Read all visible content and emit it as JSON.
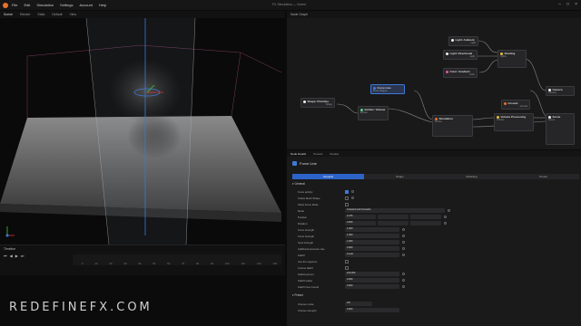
{
  "app": {
    "title": "FX Simulation — Scene"
  },
  "menu": [
    "File",
    "Edit",
    "Simulation",
    "Settings",
    "Account",
    "Help"
  ],
  "viewport_tabs": [
    "Scene",
    "Render",
    "Stats",
    "Default",
    "View"
  ],
  "timeline": {
    "title": "Timeline",
    "controls": [
      "⏮",
      "◀",
      "▶",
      "⏭"
    ],
    "ticks": [
      "0",
      "10",
      "20",
      "30",
      "40",
      "50",
      "60",
      "70",
      "80",
      "90",
      "100",
      "110",
      "120",
      "130"
    ]
  },
  "node_graph": {
    "title": "Node Graph",
    "nodes": [
      {
        "label": "Light: Ambient",
        "row": "Light"
      },
      {
        "label": "Light: Directional",
        "row": "Light"
      },
      {
        "label": "Shading",
        "row": "Lights"
      },
      {
        "label": "Color: Gradient",
        "row": "Color"
      },
      {
        "label": "Force Line",
        "row": "Force Shapes"
      },
      {
        "label": "Shape: Primitive",
        "row": "Shape"
      },
      {
        "label": "Emitter: Volume",
        "row": "Emitter"
      },
      {
        "label": "Simulation",
        "row": "Forces"
      },
      {
        "label": "Volume Processing",
        "row": "Volume"
      },
      {
        "label": "Ground",
        "row": "Ground"
      },
      {
        "label": "Camera",
        "row": "Camera"
      },
      {
        "label": "Scene",
        "row": "Scene"
      }
    ]
  },
  "props": {
    "tabs": [
      "Node Details",
      "Presets",
      "Display"
    ],
    "title": "Force Line",
    "subtabs": [
      "General",
      "Shape",
      "Modeling",
      "Preset"
    ],
    "sections": [
      "General",
      "Preset"
    ],
    "rows": [
      {
        "label": "Force activity",
        "value": ""
      },
      {
        "label": "Follow Mesh Shape",
        "value": ""
      },
      {
        "label": "Show Force Mode",
        "value": ""
      },
      {
        "label": "Mode",
        "value": "Outward and Forwards"
      },
      {
        "label": "Position",
        "value": "0.476"
      },
      {
        "label": "Rotation",
        "value": "0.000"
      },
      {
        "label": "Force strength",
        "value": "1.000"
      },
      {
        "label": "Force strength",
        "value": "1.000"
      },
      {
        "label": "Input strength",
        "value": "1.000"
      },
      {
        "label": "Additional pressure rate",
        "value": "0.000"
      },
      {
        "label": "Falloff",
        "value": "Linear"
      },
      {
        "label": "Use the segment",
        "value": ""
      },
      {
        "label": "Inverse falloff",
        "value": ""
      },
      {
        "label": "Falloff percent",
        "value": "100.000"
      },
      {
        "label": "Falloff radius",
        "value": "0.000"
      },
      {
        "label": "Falloff inner bound",
        "value": "0.000"
      },
      {
        "label": "Choose mode",
        "value": "Off"
      },
      {
        "label": "Choose strength",
        "value": "0.000"
      }
    ]
  },
  "watermark": "REDEFINEFX.COM"
}
